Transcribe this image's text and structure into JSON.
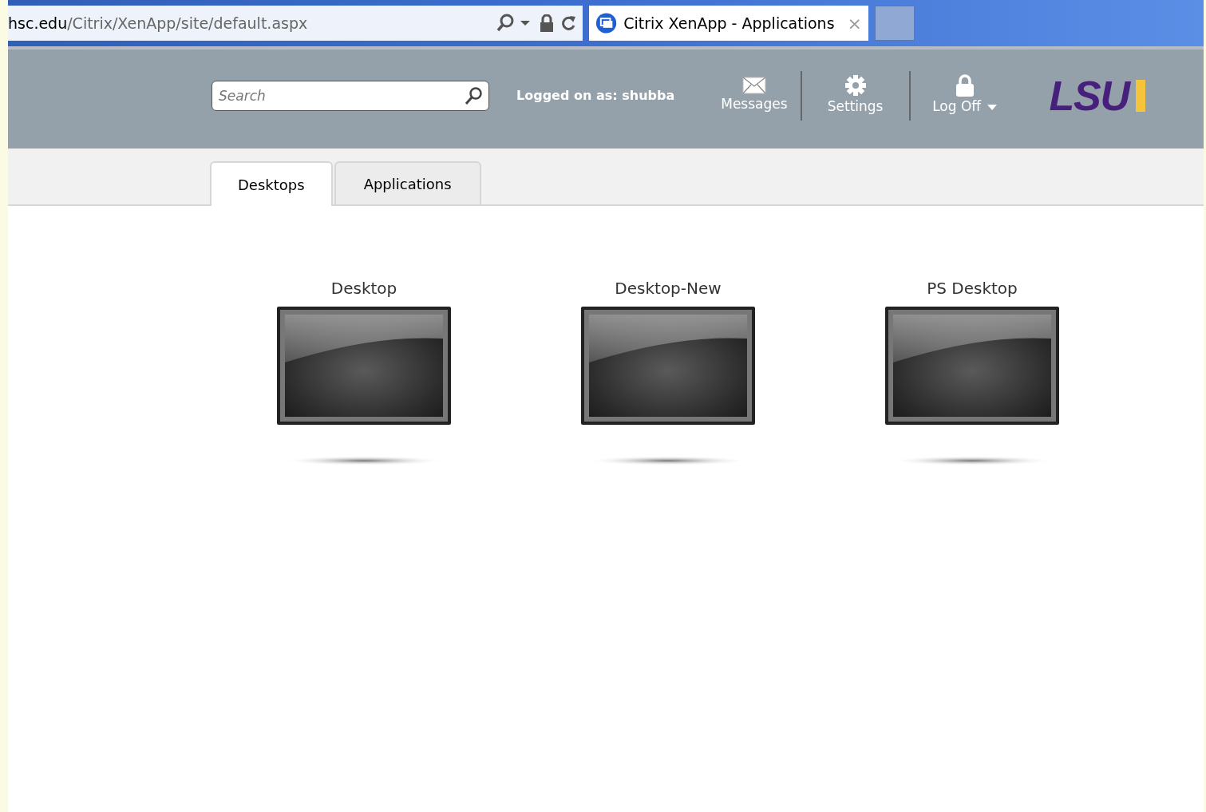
{
  "browser": {
    "address": {
      "host": "hsc.edu",
      "path": "/Citrix/XenApp/site/default.aspx"
    },
    "tab": {
      "title": "Citrix XenApp - Applications",
      "close": "×"
    }
  },
  "header": {
    "search": {
      "placeholder": "Search"
    },
    "user": "Logged on as: shubba",
    "actions": [
      {
        "kind": "messages",
        "label": "Messages"
      },
      {
        "kind": "settings",
        "label": "Settings"
      },
      {
        "kind": "logoff",
        "label": "Log Off"
      }
    ],
    "logo": "LSU"
  },
  "tabs": [
    {
      "label": "Desktops",
      "selected": true
    },
    {
      "label": "Applications",
      "selected": false
    }
  ],
  "desktops": [
    {
      "name": "Desktop"
    },
    {
      "name": "Desktop-New"
    },
    {
      "name": "PS Desktop"
    }
  ]
}
